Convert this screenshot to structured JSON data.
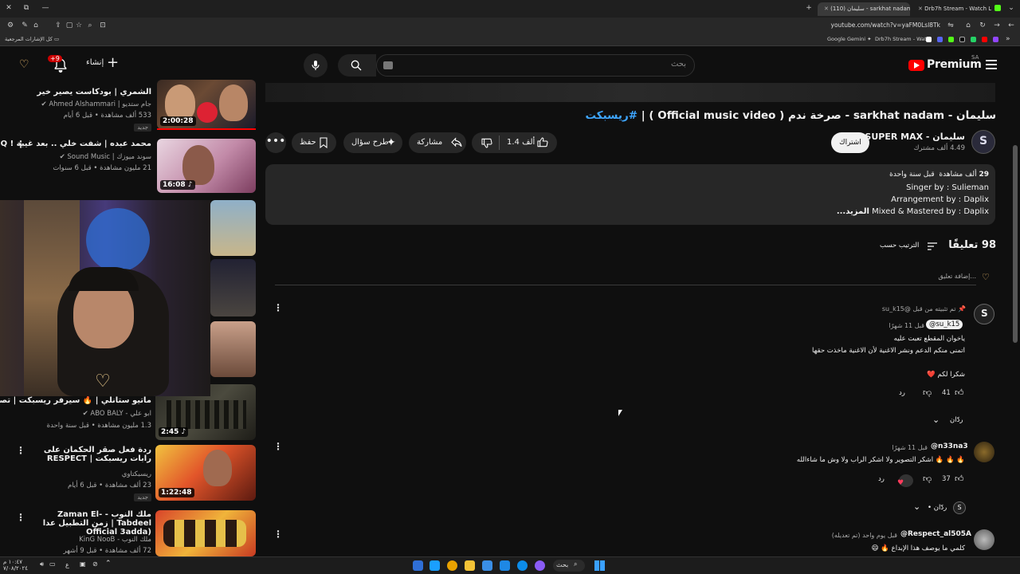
{
  "browser": {
    "tabs": [
      {
        "label": "سليمان (110) - sarkhat nadam"
      },
      {
        "label": "Drb7h Stream - Watch Live on"
      }
    ],
    "url": "youtube.com/watch?v=yaFM0Lsl8Tk",
    "bookmarks": {
      "right_folder": "كل الإشارات المرجعية",
      "items": [
        "Google Gemini",
        "Drb7h Stream - Wat..."
      ]
    }
  },
  "header": {
    "logo_text": "Premium",
    "region": "SA",
    "search_placeholder": "بحث",
    "create_label": "إنشاء",
    "notif_count": "+9"
  },
  "video": {
    "title": "سليمان - sarkhat nadam - صرخة ندم ( Official music video ) | #ريسبكت",
    "title_prefix": "سليمان - sarkhat nadam - صرخة ندم ( Official music video ) | ",
    "title_hashtag": "#ريسبكت",
    "channel_name": "سليمان - SUPER MAX",
    "subscribers": "4.49 ألف مشترك",
    "subscribe_label": "اشتراك",
    "like_count": "1.4 ألف",
    "share_label": "مشاركة",
    "ask_label": "طرح سؤال",
    "save_label": "حفظ"
  },
  "description": {
    "views": "29",
    "views_unit": "ألف مشاهدة",
    "date": "قبل سنة واحدة",
    "line1": "Singer by : Sulieman",
    "line2": "Arrangement by  : Daplix",
    "line3": "Mixed & Mastered by : Daplix",
    "more_label": "...المزيد"
  },
  "comments": {
    "count_label": "98 تعليقًا",
    "sort_label": "الترتيب حسب",
    "add_placeholder": "إضافة تعليق...",
    "items": [
      {
        "pinned": "تم تثبيته من قبل @su_k15",
        "author": "@su_k15",
        "time": "قبل 11 شهرًا",
        "line1": "ياخوان المقطع تعبت عليه",
        "line2": "اتمنى منكم الدعم ونشر الاغنية لأن الاغنية ماخذت حقها",
        "line3": "شكرا لكم ❤️",
        "likes": "41",
        "reply_label": "رد",
        "replies_label": "ردّان"
      },
      {
        "author": "@n33na3",
        "time": "قبل 11 شهرًا",
        "line1": "🔥 🔥 🔥 اشكر التصوير ولا اشكر الراب ولا وش ما شاءالله",
        "likes": "37",
        "reply_label": "رد",
        "replies_label": "• ردّان"
      },
      {
        "author": "@Respect_al505A",
        "time": "قبل يوم واحد (تم تعديله)",
        "line1": "كلمي ما يوصف هذا الإبداع 🔥 😄"
      }
    ]
  },
  "recommendations": [
    {
      "title": "الشمري | بودكاست يصير خير",
      "channel": "جام ستديو",
      "channel2": "Ahmed Alshammari",
      "meta": "533 ألف مشاهدة • قبل 6 أيام",
      "badge": "جديد",
      "duration": "2:00:28"
    },
    {
      "title": "محمد عبده | شفت خلي .. بعد غيبة ! HQ",
      "channel": "سوند ميوزك | Sound Music",
      "meta": "21 مليون مشاهدة • قبل 6 سنوات",
      "duration": "16:08"
    },
    {
      "title": "ماتيو ستانلي | 🔥 سيرفر ريسبكت | تصوي...",
      "channel": "ابو علي - ABO BALY",
      "meta": "1.3 مليون مشاهدة • قبل سنة واحدة",
      "duration": "2:45"
    },
    {
      "title": "ردة فعل صقر الحكمان على رابات ريسبكت | RESPECT",
      "channel": "ريسبكتاوي",
      "meta": "23 ألف مشاهدة • قبل 6 أيام",
      "badge": "جديد",
      "duration": "1:22:48"
    },
    {
      "title": "ملك النوب - Zaman El-Tabdeel | زمن التطبيل عدا (Official 3adda",
      "channel": "ملك النوب - KinG NooB",
      "meta": "72 ألف مشاهدة • قبل 9 أشهر",
      "duration": ""
    }
  ],
  "taskbar": {
    "search_label": "بحث",
    "time": "١٠:٤٧ م",
    "date": "٧/٠٨/٢٠٢٤",
    "lang": "ع"
  },
  "colors": {
    "yt_red": "#ff0000",
    "accent_blue": "#3ea6ff",
    "bg": "#0f0f0f",
    "surface": "#272727"
  }
}
